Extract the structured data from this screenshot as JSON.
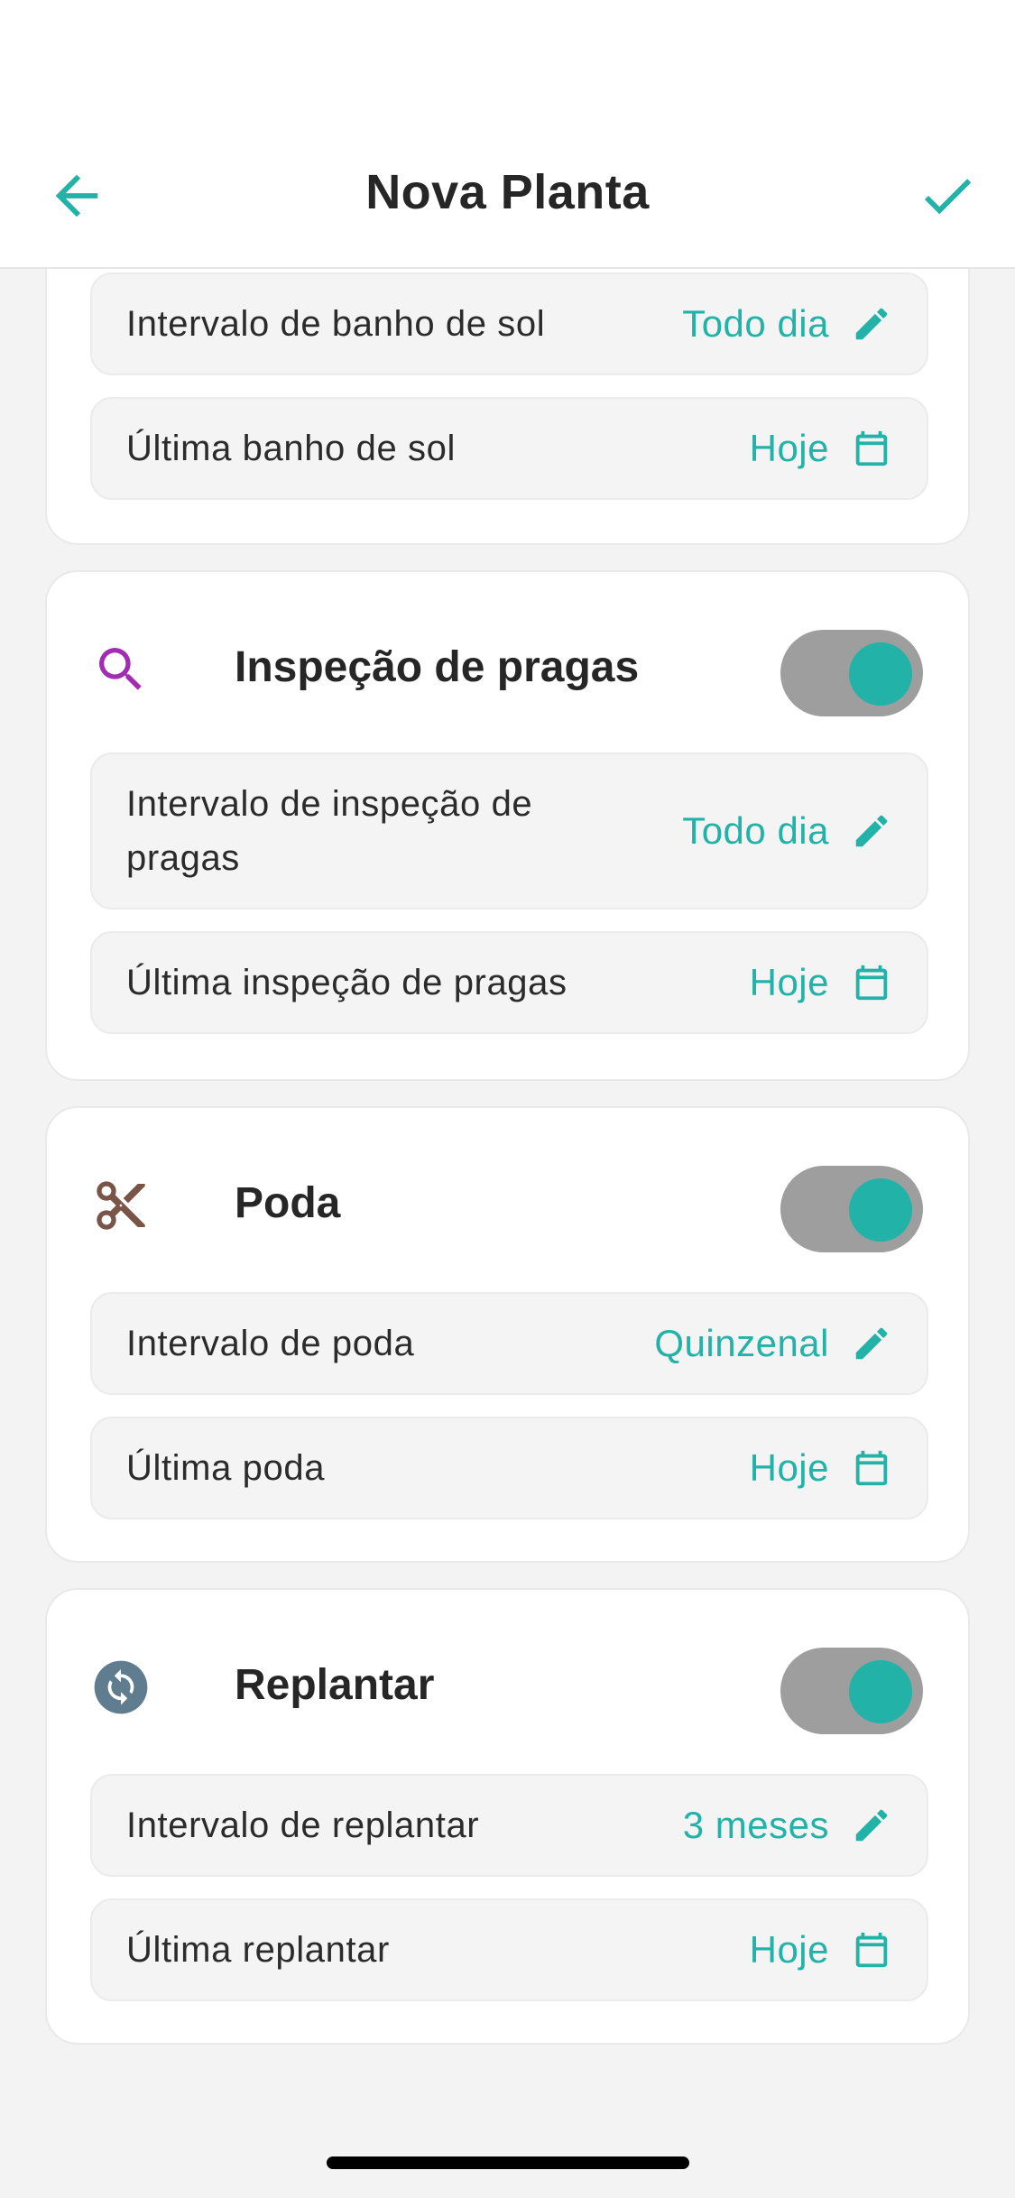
{
  "header": {
    "title": "Nova Planta"
  },
  "colors": {
    "accent": "#22b2a8",
    "toggle_track": "#9e9e9e",
    "pest_icon": "#a22db3",
    "prune_icon": "#7a5547",
    "repot_icon": "#5f7d8f"
  },
  "top_card": {
    "rows": [
      {
        "label": "Intervalo de banho de sol",
        "value": "Todo dia",
        "icon": "pencil-icon"
      },
      {
        "label": "Última banho de sol",
        "value": "Hoje",
        "icon": "calendar-icon"
      }
    ]
  },
  "pragas": {
    "title": "Inspeção de pragas",
    "icon": "search-icon",
    "enabled": true,
    "rows": [
      {
        "label": "Intervalo de inspeção de pragas",
        "value": "Todo dia",
        "icon": "pencil-icon"
      },
      {
        "label": "Última inspeção de pragas",
        "value": "Hoje",
        "icon": "calendar-icon"
      }
    ]
  },
  "poda": {
    "title": "Poda",
    "icon": "scissors-icon",
    "enabled": true,
    "rows": [
      {
        "label": "Intervalo de poda",
        "value": "Quinzenal",
        "icon": "pencil-icon"
      },
      {
        "label": "Última poda",
        "value": "Hoje",
        "icon": "calendar-icon"
      }
    ]
  },
  "replantar": {
    "title": "Replantar",
    "icon": "sync-icon",
    "enabled": true,
    "rows": [
      {
        "label": "Intervalo de replantar",
        "value": "3 meses",
        "icon": "pencil-icon"
      },
      {
        "label": "Última replantar",
        "value": "Hoje",
        "icon": "calendar-icon"
      }
    ]
  }
}
